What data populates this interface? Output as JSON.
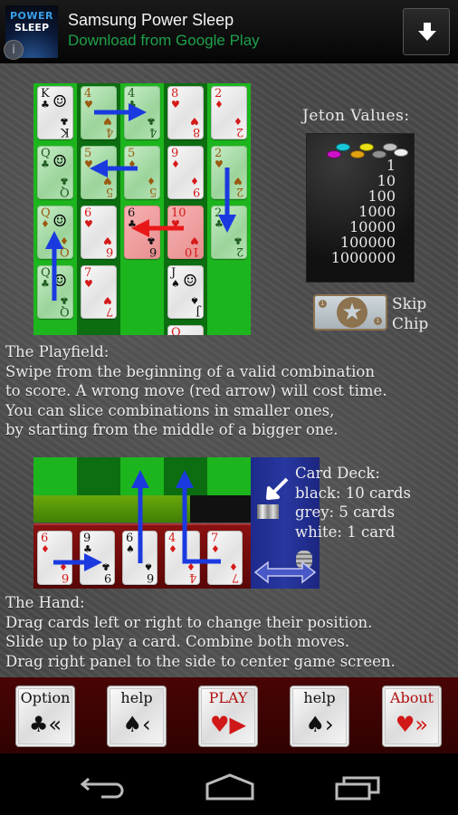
{
  "ad": {
    "logo_line1": "POWER",
    "logo_line2": "SLEEP",
    "title": "Samsung Power Sleep",
    "subtitle": "Download from Google Play",
    "info_glyph": "i",
    "download_icon": "download-arrow-icon"
  },
  "playfield": {
    "columns": [
      {
        "shade": "light",
        "cards": [
          {
            "rank": "K",
            "suit": "♣",
            "color": "blk",
            "style": "white",
            "face": true
          },
          {
            "rank": "Q",
            "suit": "♣",
            "color": "dgr",
            "style": "green",
            "face": true
          },
          {
            "rank": "Q",
            "suit": "♦",
            "color": "brn",
            "style": "green",
            "face": true
          },
          {
            "rank": "Q",
            "suit": "♣",
            "color": "dgr",
            "style": "green",
            "face": true
          }
        ]
      },
      {
        "shade": "dark",
        "cards": [
          {
            "rank": "4",
            "suit": "♥",
            "color": "brn",
            "style": "green"
          },
          {
            "rank": "5",
            "suit": "♥",
            "color": "brn",
            "style": "green"
          },
          {
            "rank": "6",
            "suit": "♥",
            "color": "red",
            "style": "white"
          },
          {
            "rank": "7",
            "suit": "♥",
            "color": "red",
            "style": "white"
          }
        ]
      },
      {
        "shade": "light",
        "cards": [
          {
            "rank": "4",
            "suit": "♣",
            "color": "dgr",
            "style": "green"
          },
          {
            "rank": "5",
            "suit": "♦",
            "color": "brn",
            "style": "green"
          },
          {
            "rank": "6",
            "suit": "♣",
            "color": "blk",
            "style": "pink"
          }
        ]
      },
      {
        "shade": "dark",
        "cards": [
          {
            "rank": "8",
            "suit": "♥",
            "color": "red",
            "style": "white"
          },
          {
            "rank": "9",
            "suit": "♦",
            "color": "red",
            "style": "white"
          },
          {
            "rank": "10",
            "suit": "♥",
            "color": "red",
            "style": "pink"
          },
          {
            "rank": "J",
            "suit": "♠",
            "color": "blk",
            "style": "white",
            "face": true
          },
          {
            "rank": "Q",
            "suit": "",
            "color": "red",
            "style": "white"
          }
        ]
      },
      {
        "shade": "light",
        "cards": [
          {
            "rank": "2",
            "suit": "♦",
            "color": "red",
            "style": "white"
          },
          {
            "rank": "2",
            "suit": "♥",
            "color": "brn",
            "style": "green"
          },
          {
            "rank": "2",
            "suit": "♣",
            "color": "dgr",
            "style": "green"
          }
        ]
      }
    ]
  },
  "jeton": {
    "title": "Jeton Values:",
    "chip_colors": [
      "#d010c8",
      "#18c8d8",
      "#e0a010",
      "#e8e010",
      "#909090",
      "#c0c0c0",
      "#f0f0f0"
    ],
    "values": [
      "1",
      "10",
      "100",
      "1000",
      "10000",
      "100000",
      "1000000"
    ]
  },
  "skip_chip": {
    "line1": "Skip",
    "line2": "Chip",
    "badge_value": "1"
  },
  "playfield_text": {
    "heading": "The Playfield:",
    "lines": [
      "Swipe from the beginning of a valid combination",
      "to score. A wrong move (red arrow) will cost time.",
      "You can slice combinations in smaller ones,",
      "by starting from the middle of a bigger one."
    ]
  },
  "hand": {
    "slot_shades": [
      "light",
      "dark",
      "light",
      "dark",
      "light"
    ],
    "time_bar_fraction": 0.72,
    "cards": [
      {
        "rank": "6",
        "suit": "♦",
        "color": "red"
      },
      {
        "rank": "9",
        "suit": "♣",
        "color": "blk"
      },
      {
        "rank": "6",
        "suit": "♠",
        "color": "blk"
      },
      {
        "rank": "4",
        "suit": "♦",
        "color": "red"
      },
      {
        "rank": "7",
        "suit": "♦",
        "color": "red"
      }
    ]
  },
  "deck": {
    "heading": "Card Deck:",
    "lines": [
      "black: 10 cards",
      "grey: 5 cards",
      "white: 1 card"
    ]
  },
  "hand_text": {
    "heading": "The Hand:",
    "lines": [
      "Drag cards left or right to change their position.",
      "Slide up to play a card. Combine both moves.",
      "Drag right panel to the side to center game screen."
    ]
  },
  "menu": [
    {
      "label": "Option",
      "suit": "♣",
      "suit_color": "#111",
      "label_color": "#111",
      "glyph": "«"
    },
    {
      "label": "help",
      "suit": "♠",
      "suit_color": "#111",
      "label_color": "#111",
      "glyph": "‹"
    },
    {
      "label": "PLAY",
      "suit": "♥",
      "suit_color": "#d01818",
      "label_color": "#b01010",
      "glyph": "▶"
    },
    {
      "label": "help",
      "suit": "♠",
      "suit_color": "#111",
      "label_color": "#111",
      "glyph": "›"
    },
    {
      "label": "About",
      "suit": "♥",
      "suit_color": "#d01818",
      "label_color": "#b01010",
      "glyph": "»"
    }
  ],
  "nav": {
    "back": "back-icon",
    "home": "home-icon",
    "recents": "recents-icon"
  }
}
